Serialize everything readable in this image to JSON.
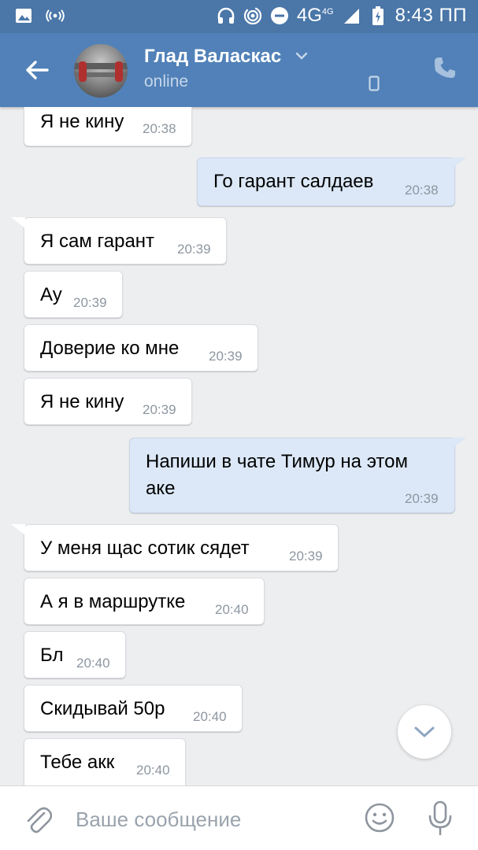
{
  "status_bar": {
    "network": "4G",
    "network_sup": "4G",
    "time": "8:43 ПП"
  },
  "header": {
    "contact_name": "Глад Валаскас",
    "status": "online"
  },
  "messages": [
    {
      "dir": "in",
      "text": "Я не кину",
      "time": "20:38"
    },
    {
      "dir": "out",
      "text": "Го гарант салдаев",
      "time": "20:38"
    },
    {
      "dir": "in",
      "text": "Я сам гарант",
      "time": "20:39"
    },
    {
      "dir": "in",
      "text": "Ау",
      "time": "20:39"
    },
    {
      "dir": "in",
      "text": "Доверие ко мне",
      "time": "20:39"
    },
    {
      "dir": "in",
      "text": "Я не кину",
      "time": "20:39"
    },
    {
      "dir": "out",
      "text": "Напиши в чате Тимур на этом",
      "text2": "аке",
      "time": "20:39"
    },
    {
      "dir": "in",
      "text": "У меня щас сотик сядет",
      "time": "20:39"
    },
    {
      "dir": "in",
      "text": "А я в маршрутке",
      "time": "20:40"
    },
    {
      "dir": "in",
      "text": "Бл",
      "time": "20:40"
    },
    {
      "dir": "in",
      "text": "Скидывай 50р",
      "time": "20:40"
    },
    {
      "dir": "in",
      "text": "Тебе акк",
      "time": "20:40"
    }
  ],
  "composer": {
    "placeholder": "Ваше сообщение"
  },
  "colors": {
    "status_bar": "#4a76a8",
    "header": "#5181b8",
    "background": "#edeef0",
    "incoming_bubble": "#ffffff",
    "outgoing_bubble": "#dce8f7"
  }
}
